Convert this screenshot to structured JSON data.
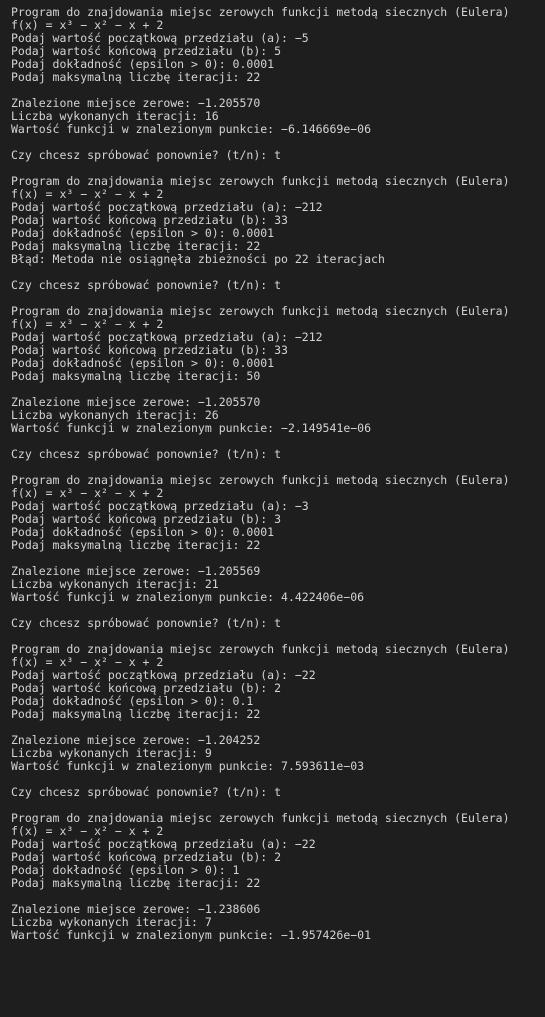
{
  "terminal": {
    "lines": [
      "Program do znajdowania miejsc zerowych funkcji metodą siecznych (Eulera)",
      "f(x) = x³ − x² − x + 2",
      "Podaj wartość początkową przedziału (a): −5",
      "Podaj wartość końcową przedziału (b): 5",
      "Podaj dokładność (epsilon > 0): 0.0001",
      "Podaj maksymalną liczbę iteracji: 22",
      "",
      "Znalezione miejsce zerowe: −1.205570",
      "Liczba wykonanych iteracji: 16",
      "Wartość funkcji w znalezionym punkcie: −6.146669e−06",
      "",
      "Czy chcesz spróbować ponownie? (t/n): t",
      "",
      "Program do znajdowania miejsc zerowych funkcji metodą siecznych (Eulera)",
      "f(x) = x³ − x² − x + 2",
      "Podaj wartość początkową przedziału (a): −212",
      "Podaj wartość końcową przedziału (b): 33",
      "Podaj dokładność (epsilon > 0): 0.0001",
      "Podaj maksymalną liczbę iteracji: 22",
      "Błąd: Metoda nie osiągnęła zbieżności po 22 iteracjach",
      "",
      "Czy chcesz spróbować ponownie? (t/n): t",
      "",
      "Program do znajdowania miejsc zerowych funkcji metodą siecznych (Eulera)",
      "f(x) = x³ − x² − x + 2",
      "Podaj wartość początkową przedziału (a): −212",
      "Podaj wartość końcową przedziału (b): 33",
      "Podaj dokładność (epsilon > 0): 0.0001",
      "Podaj maksymalną liczbę iteracji: 50",
      "",
      "Znalezione miejsce zerowe: −1.205570",
      "Liczba wykonanych iteracji: 26",
      "Wartość funkcji w znalezionym punkcie: −2.149541e−06",
      "",
      "Czy chcesz spróbować ponownie? (t/n): t",
      "",
      "Program do znajdowania miejsc zerowych funkcji metodą siecznych (Eulera)",
      "f(x) = x³ − x² − x + 2",
      "Podaj wartość początkową przedziału (a): −3",
      "Podaj wartość końcową przedziału (b): 3",
      "Podaj dokładność (epsilon > 0): 0.0001",
      "Podaj maksymalną liczbę iteracji: 22",
      "",
      "Znalezione miejsce zerowe: −1.205569",
      "Liczba wykonanych iteracji: 21",
      "Wartość funkcji w znalezionym punkcie: 4.422406e−06",
      "",
      "Czy chcesz spróbować ponownie? (t/n): t",
      "",
      "Program do znajdowania miejsc zerowych funkcji metodą siecznych (Eulera)",
      "f(x) = x³ − x² − x + 2",
      "Podaj wartość początkową przedziału (a): −22",
      "Podaj wartość końcową przedziału (b): 2",
      "Podaj dokładność (epsilon > 0): 0.1",
      "Podaj maksymalną liczbę iteracji: 22",
      "",
      "Znalezione miejsce zerowe: −1.204252",
      "Liczba wykonanych iteracji: 9",
      "Wartość funkcji w znalezionym punkcie: 7.593611e−03",
      "",
      "Czy chcesz spróbować ponownie? (t/n): t",
      "",
      "Program do znajdowania miejsc zerowych funkcji metodą siecznych (Eulera)",
      "f(x) = x³ − x² − x + 2",
      "Podaj wartość początkową przedziału (a): −22",
      "Podaj wartość końcową przedziału (b): 2",
      "Podaj dokładność (epsilon > 0): 1",
      "Podaj maksymalną liczbę iteracji: 22",
      "",
      "Znalezione miejsce zerowe: −1.238606",
      "Liczba wykonanych iteracji: 7",
      "Wartość funkcji w znalezionym punkcie: −1.957426e−01"
    ]
  }
}
